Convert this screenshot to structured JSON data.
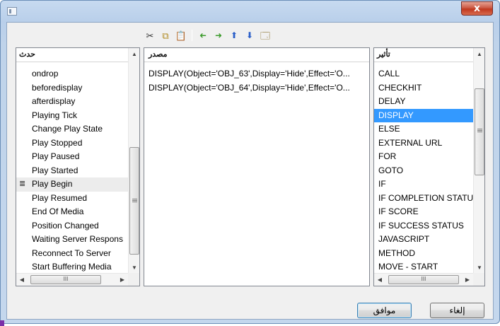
{
  "toolbar": {
    "cut": "✂",
    "copy": "⧉",
    "paste": "📋",
    "move_left": "➜",
    "move_right": "➜",
    "move_up": "⬆",
    "move_down": "⬇",
    "properties": "🗔"
  },
  "events_panel": {
    "header": "حدث",
    "current_marker": "≣",
    "items": [
      "ondrop",
      "beforedisplay",
      "afterdisplay",
      "Playing Tick",
      "Change Play State",
      "Play Stopped",
      "Play Paused",
      "Play Started",
      "Play Begin",
      "Play Resumed",
      "End Of Media",
      "Position Changed",
      "Waiting Server Respons",
      "Reconnect To Server",
      "Start Buffering Media"
    ],
    "current_index": 8
  },
  "source_panel": {
    "header": "مصدر",
    "items": [
      "DISPLAY(Object='OBJ_63',Display='Hide',Effect='O...",
      "DISPLAY(Object='OBJ_64',Display='Hide',Effect='O..."
    ]
  },
  "actions_panel": {
    "header": "تأثير",
    "items": [
      "CALL",
      "CHECKHIT",
      "DELAY",
      "DISPLAY",
      "ELSE",
      "EXTERNAL URL",
      "FOR",
      "GOTO",
      "IF",
      "IF COMPLETION STATUS",
      "IF SCORE",
      "IF SUCCESS STATUS",
      "JAVASCRIPT",
      "METHOD",
      "MOVE - START"
    ],
    "selected_index": 3
  },
  "scroll": {
    "up": "▲",
    "down": "▼",
    "left": "◀",
    "right": "▶",
    "thumb": "III"
  },
  "buttons": {
    "ok": "موافق",
    "cancel": "إلغاء"
  },
  "window": {
    "close": "x"
  },
  "colors": {
    "selection": "#3399ff",
    "title_gradient_top": "#c7daf0",
    "close_button": "#c0381f"
  }
}
